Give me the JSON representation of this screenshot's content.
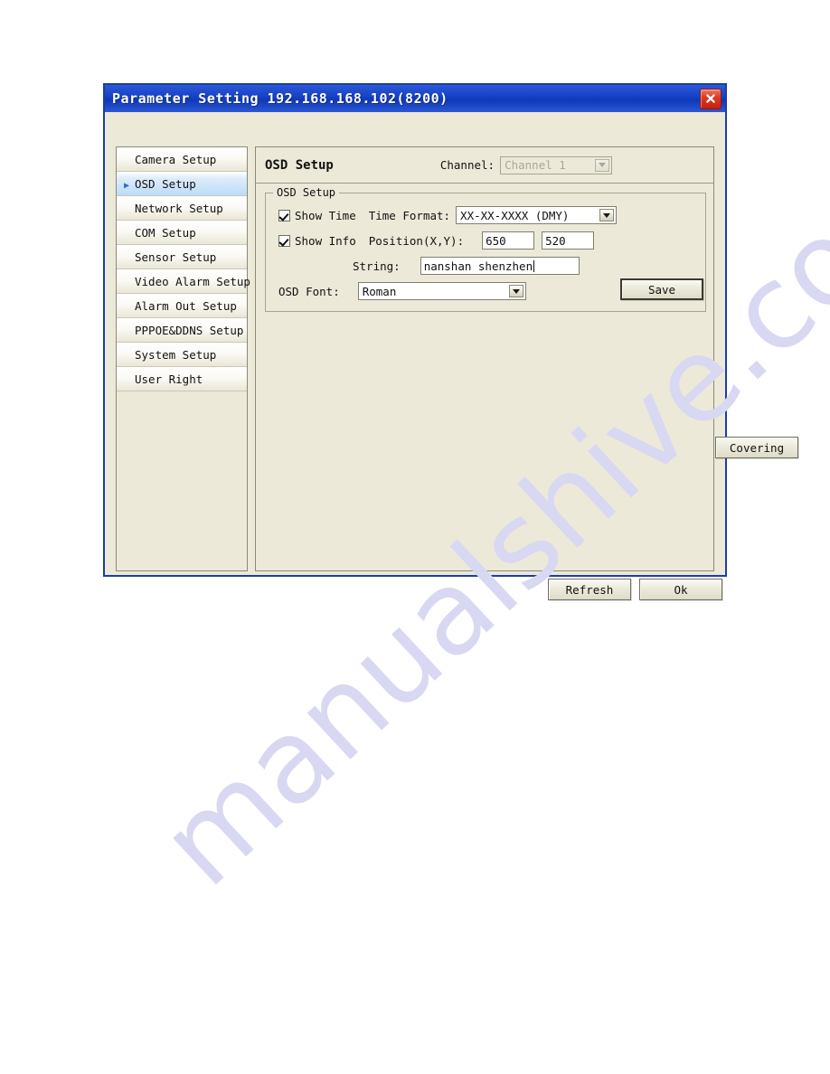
{
  "window": {
    "title": "Parameter Setting 192.168.168.102(8200)",
    "close_icon": "close-icon"
  },
  "sidebar": {
    "items": [
      {
        "label": "Camera Setup",
        "selected": false
      },
      {
        "label": "OSD Setup",
        "selected": true
      },
      {
        "label": "Network Setup",
        "selected": false
      },
      {
        "label": "COM Setup",
        "selected": false
      },
      {
        "label": "Sensor Setup",
        "selected": false
      },
      {
        "label": "Video Alarm Setup",
        "selected": false
      },
      {
        "label": "Alarm Out Setup",
        "selected": false
      },
      {
        "label": "PPPOE&DDNS Setup",
        "selected": false
      },
      {
        "label": "System Setup",
        "selected": false
      },
      {
        "label": "User Right",
        "selected": false
      }
    ],
    "selected_arrow_icon": "triangle-right-icon"
  },
  "content": {
    "panel_title": "OSD Setup",
    "channel": {
      "label": "Channel:",
      "value": "Channel 1",
      "disabled": true,
      "dropdown_icon": "chevron-down-icon"
    },
    "group": {
      "legend": "OSD Setup",
      "show_time": {
        "label": "Show Time",
        "checked": true
      },
      "show_info": {
        "label": "Show Info",
        "checked": true
      },
      "time_format": {
        "label": "Time Format:",
        "value": "XX-XX-XXXX (DMY)",
        "dropdown_icon": "chevron-down-icon"
      },
      "position": {
        "label": "Position(X,Y):",
        "x_value": "650",
        "y_value": "520"
      },
      "string": {
        "label": "String:",
        "value": "nanshan shenzhen"
      },
      "osd_font": {
        "label": "OSD Font:",
        "value": "Roman",
        "dropdown_icon": "chevron-down-icon"
      },
      "save_label": "Save"
    },
    "covering_label": "Covering"
  },
  "footer": {
    "refresh_label": "Refresh",
    "ok_label": "Ok"
  },
  "watermark": {
    "text": "manualshive.com"
  },
  "colors": {
    "titlebar_blue": "#1540c4",
    "dialog_face": "#ece9d8",
    "close_red": "#df3a24",
    "selection_blue": "#bcdcf7",
    "watermark_lavender": "#d9d8f2"
  }
}
